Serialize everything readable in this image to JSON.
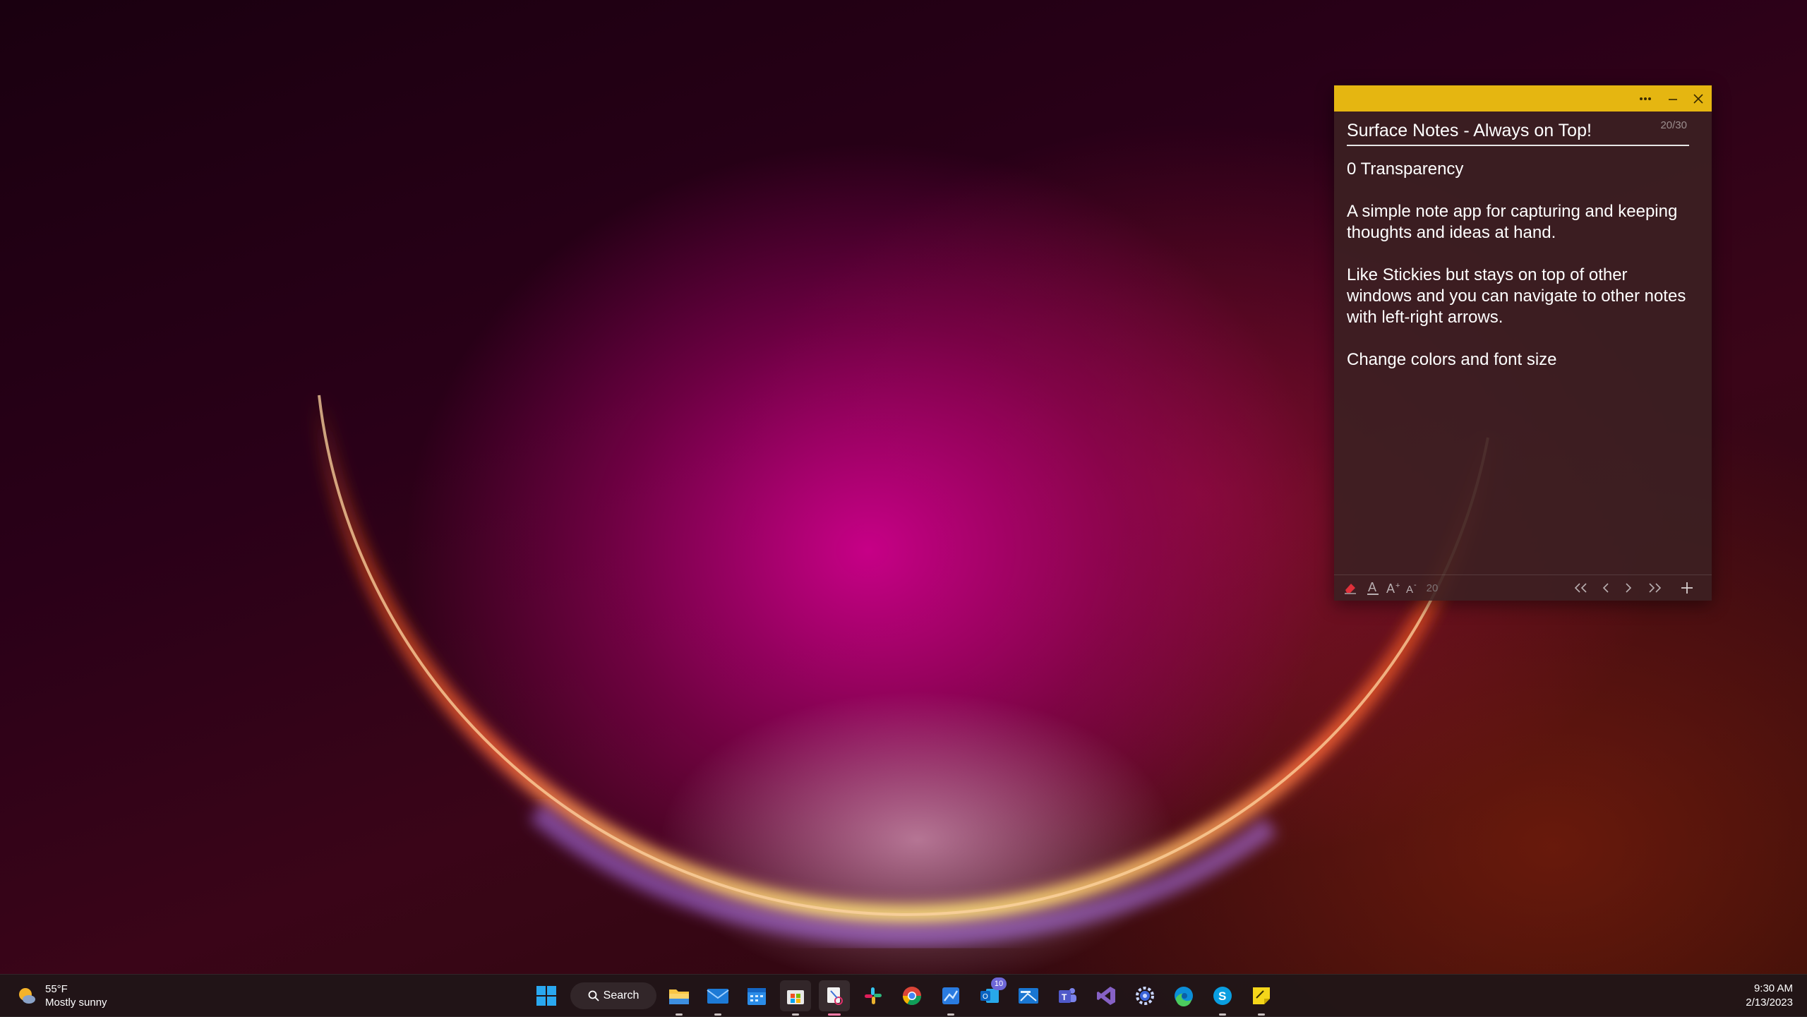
{
  "note": {
    "counter": "20/30",
    "title": "Surface Notes - Always on Top!",
    "paragraphs": [
      "0 Transparency",
      "A simple note app for capturing and keeping thoughts and ideas at hand.",
      "Like Stickies but stays on top of other windows and you can navigate to other notes with left-right arrows.",
      "Change colors and font size"
    ],
    "font_size": "20",
    "accent_color": "#e5b611",
    "titlebar_icons": [
      "more-icon",
      "minimize-icon",
      "close-icon"
    ],
    "toolbar_icons": [
      "eraser-icon",
      "text-color-icon",
      "font-increase-icon",
      "font-decrease-icon",
      "first-note-icon",
      "prev-note-icon",
      "next-note-icon",
      "last-note-icon",
      "add-note-icon"
    ]
  },
  "taskbar": {
    "weather": {
      "temp": "55°F",
      "condition": "Mostly sunny"
    },
    "search_label": "Search",
    "apps": [
      {
        "name": "file-explorer"
      },
      {
        "name": "mail"
      },
      {
        "name": "calendar"
      },
      {
        "name": "microsoft-store"
      },
      {
        "name": "snipping-tool"
      },
      {
        "name": "slack"
      },
      {
        "name": "chrome"
      },
      {
        "name": "photos"
      },
      {
        "name": "outlook",
        "badge": "10"
      },
      {
        "name": "mail-alt"
      },
      {
        "name": "teams"
      },
      {
        "name": "visual-studio"
      },
      {
        "name": "settings"
      },
      {
        "name": "edge"
      },
      {
        "name": "skype"
      },
      {
        "name": "sticky-notes"
      }
    ],
    "time": "9:30 AM",
    "date": "2/13/2023"
  }
}
